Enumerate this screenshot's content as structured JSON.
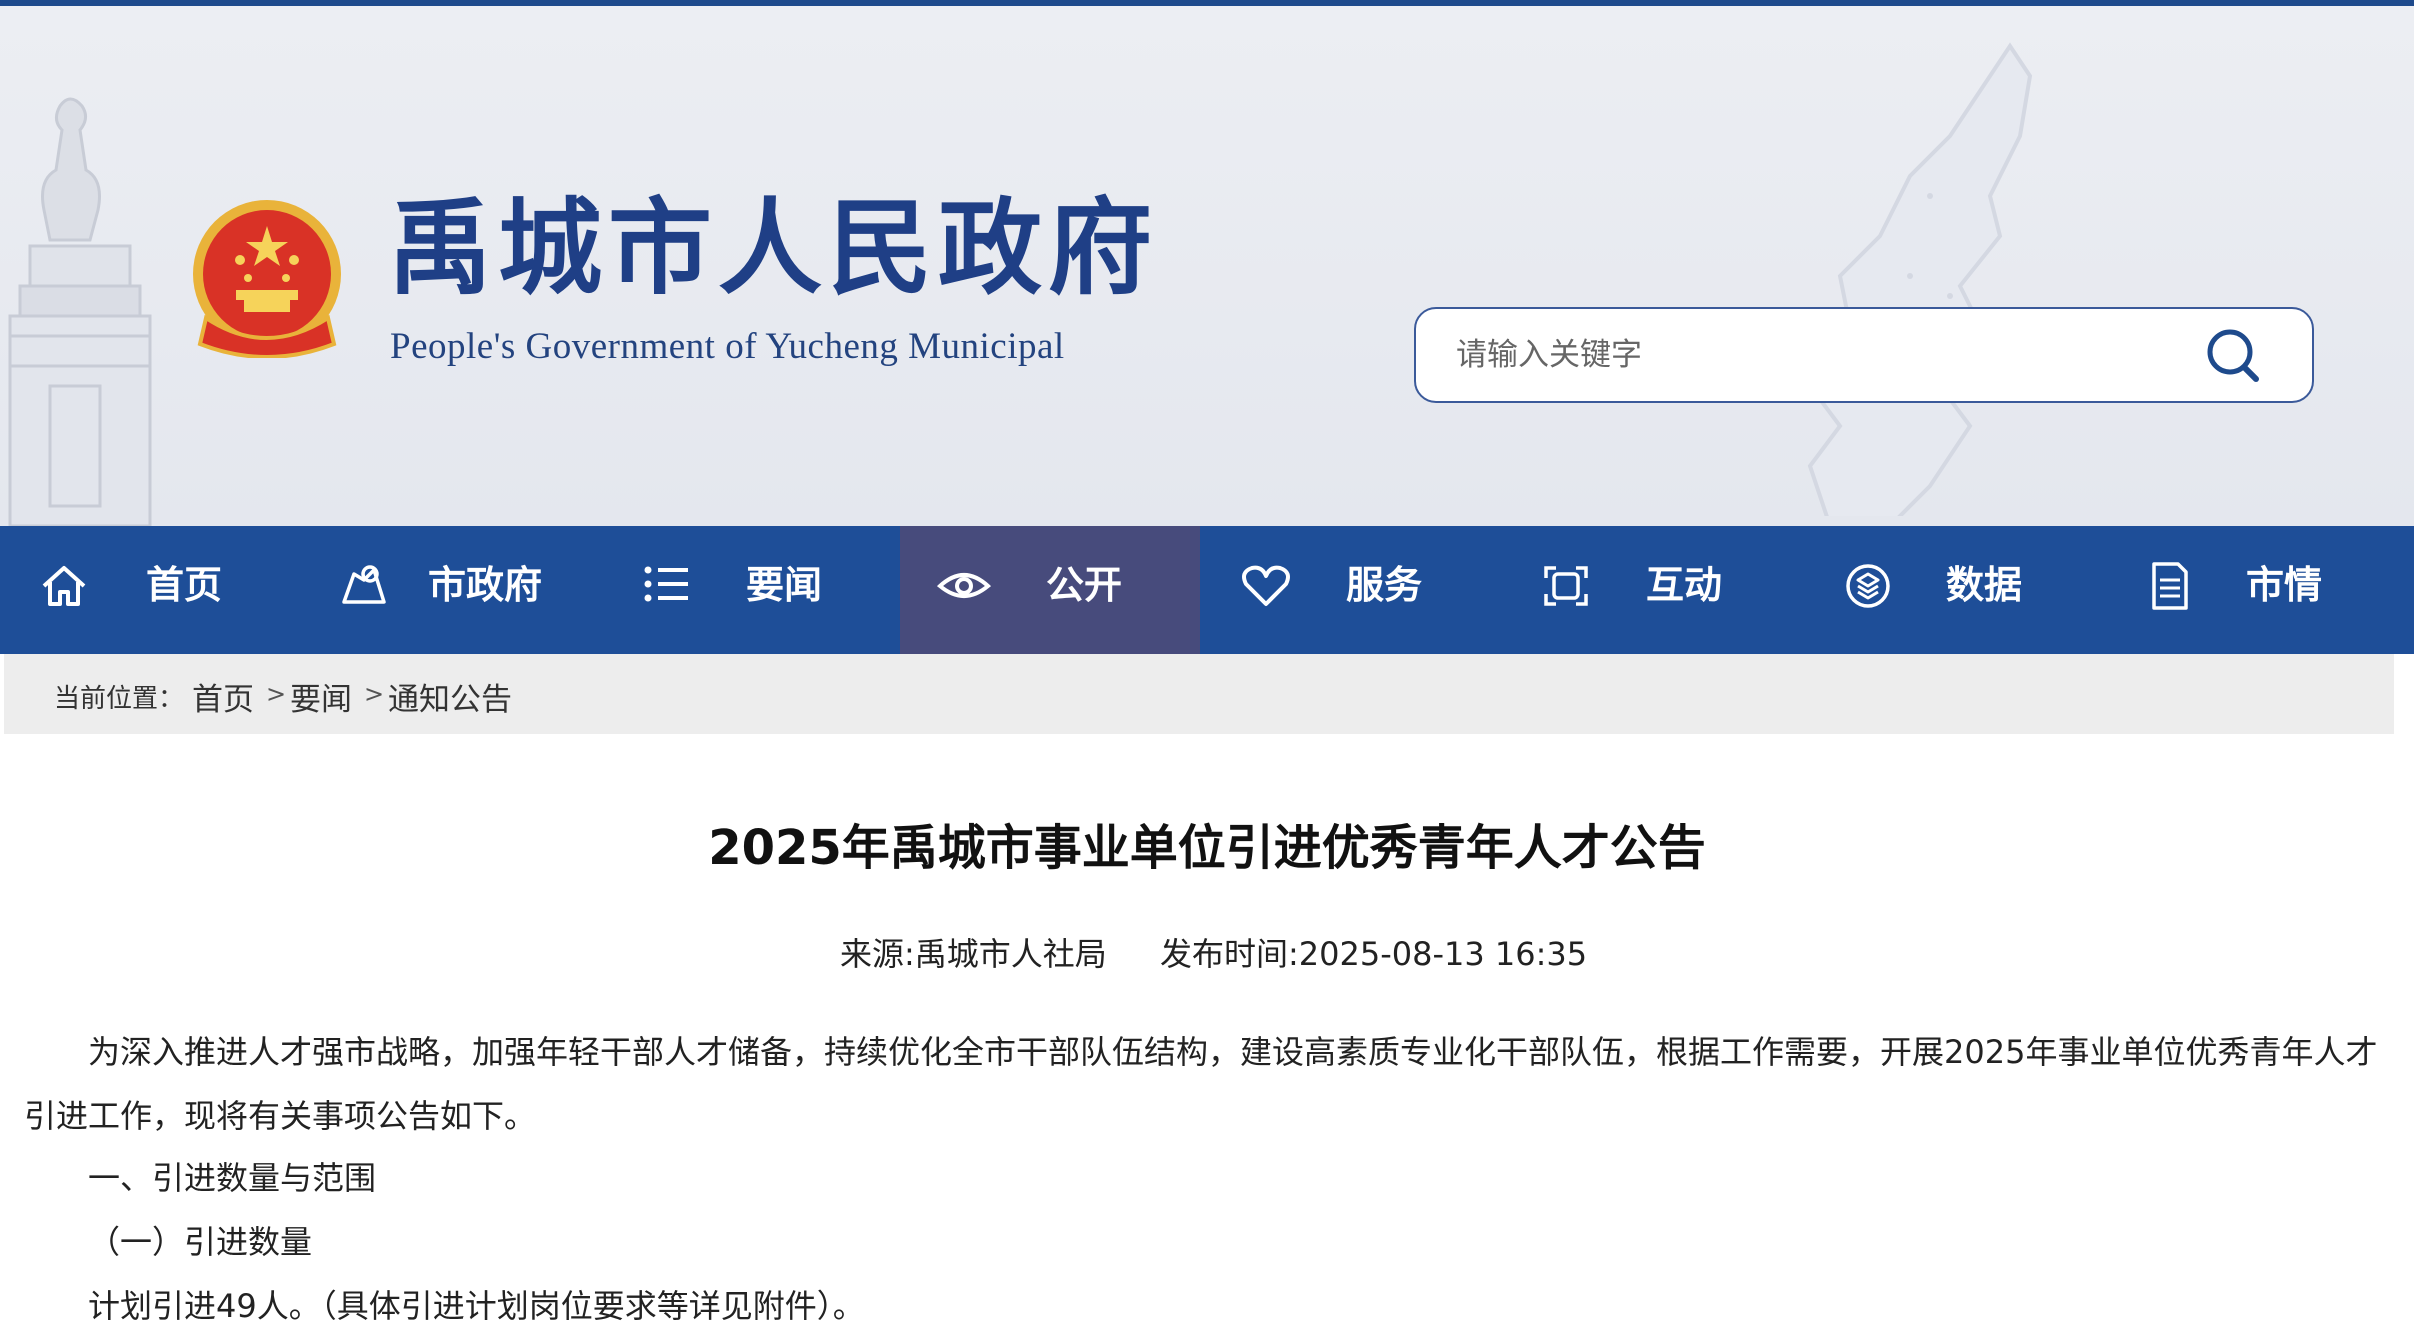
{
  "header": {
    "title": "禹城市人民政府",
    "subtitle": "People's Government of  Yucheng Municipal"
  },
  "search": {
    "placeholder": "请输入关键字",
    "icon": "search-icon"
  },
  "nav": {
    "items": [
      {
        "label": "首页",
        "icon": "home-icon",
        "active": false
      },
      {
        "label": "市政府",
        "icon": "map-pin-icon",
        "active": false
      },
      {
        "label": "要闻",
        "icon": "list-icon",
        "active": false
      },
      {
        "label": "公开",
        "icon": "eye-icon",
        "active": true
      },
      {
        "label": "服务",
        "icon": "heart-icon",
        "active": false
      },
      {
        "label": "互动",
        "icon": "interact-icon",
        "active": false
      },
      {
        "label": "数据",
        "icon": "data-icon",
        "active": false
      },
      {
        "label": "市情",
        "icon": "document-icon",
        "active": false
      }
    ],
    "active_color": "#474b7c",
    "bar_color": "#1e4e98"
  },
  "breadcrumb": {
    "prefix": "当前位置：",
    "items": [
      "首页",
      "要闻",
      "通知公告"
    ],
    "separator": ">"
  },
  "article": {
    "title": "2025年禹城市事业单位引进优秀青年人才公告",
    "source": "来源:禹城市人社局",
    "published": "发布时间:2025-08-13 16:35",
    "paragraphs": [
      "为深入推进人才强市战略，加强年轻干部人才储备，持续优化全市干部队伍结构，建设高素质专业化干部队伍，根据工作需要，开展2025年事业单位优秀青年人才引进工作，现将有关事项公告如下。",
      "一、引进数量与范围",
      "（一）引进数量",
      "计划引进49人。（具体引进计划岗位要求等详见附件）。"
    ]
  }
}
